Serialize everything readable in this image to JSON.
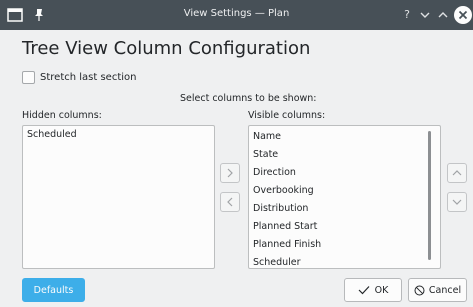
{
  "window": {
    "title": "View Settings — Plan"
  },
  "heading": "Tree View Column Configuration",
  "stretch_label": "Stretch last section",
  "select_prompt": "Select columns to be shown:",
  "hidden": {
    "label": "Hidden columns:",
    "items": [
      "Scheduled"
    ]
  },
  "visible": {
    "label": "Visible columns:",
    "items": [
      "Name",
      "State",
      "Direction",
      "Overbooking",
      "Distribution",
      "Planned Start",
      "Planned Finish",
      "Scheduler"
    ]
  },
  "buttons": {
    "defaults": "Defaults",
    "ok": "OK",
    "cancel": "Cancel"
  },
  "icons": {
    "app": "window-icon",
    "pin": "pin-icon",
    "help": "help-icon",
    "minimize": "chevron-down-icon",
    "maximize": "chevron-up-icon",
    "close": "close-icon",
    "add": "chevron-right-icon",
    "remove": "chevron-left-icon",
    "move_up": "chevron-up-icon",
    "move_down": "chevron-down-icon",
    "ok": "check-icon",
    "cancel": "cancel-icon"
  },
  "colors": {
    "titlebar": "#475057",
    "accent": "#3daee9",
    "background": "#eff0f1"
  }
}
